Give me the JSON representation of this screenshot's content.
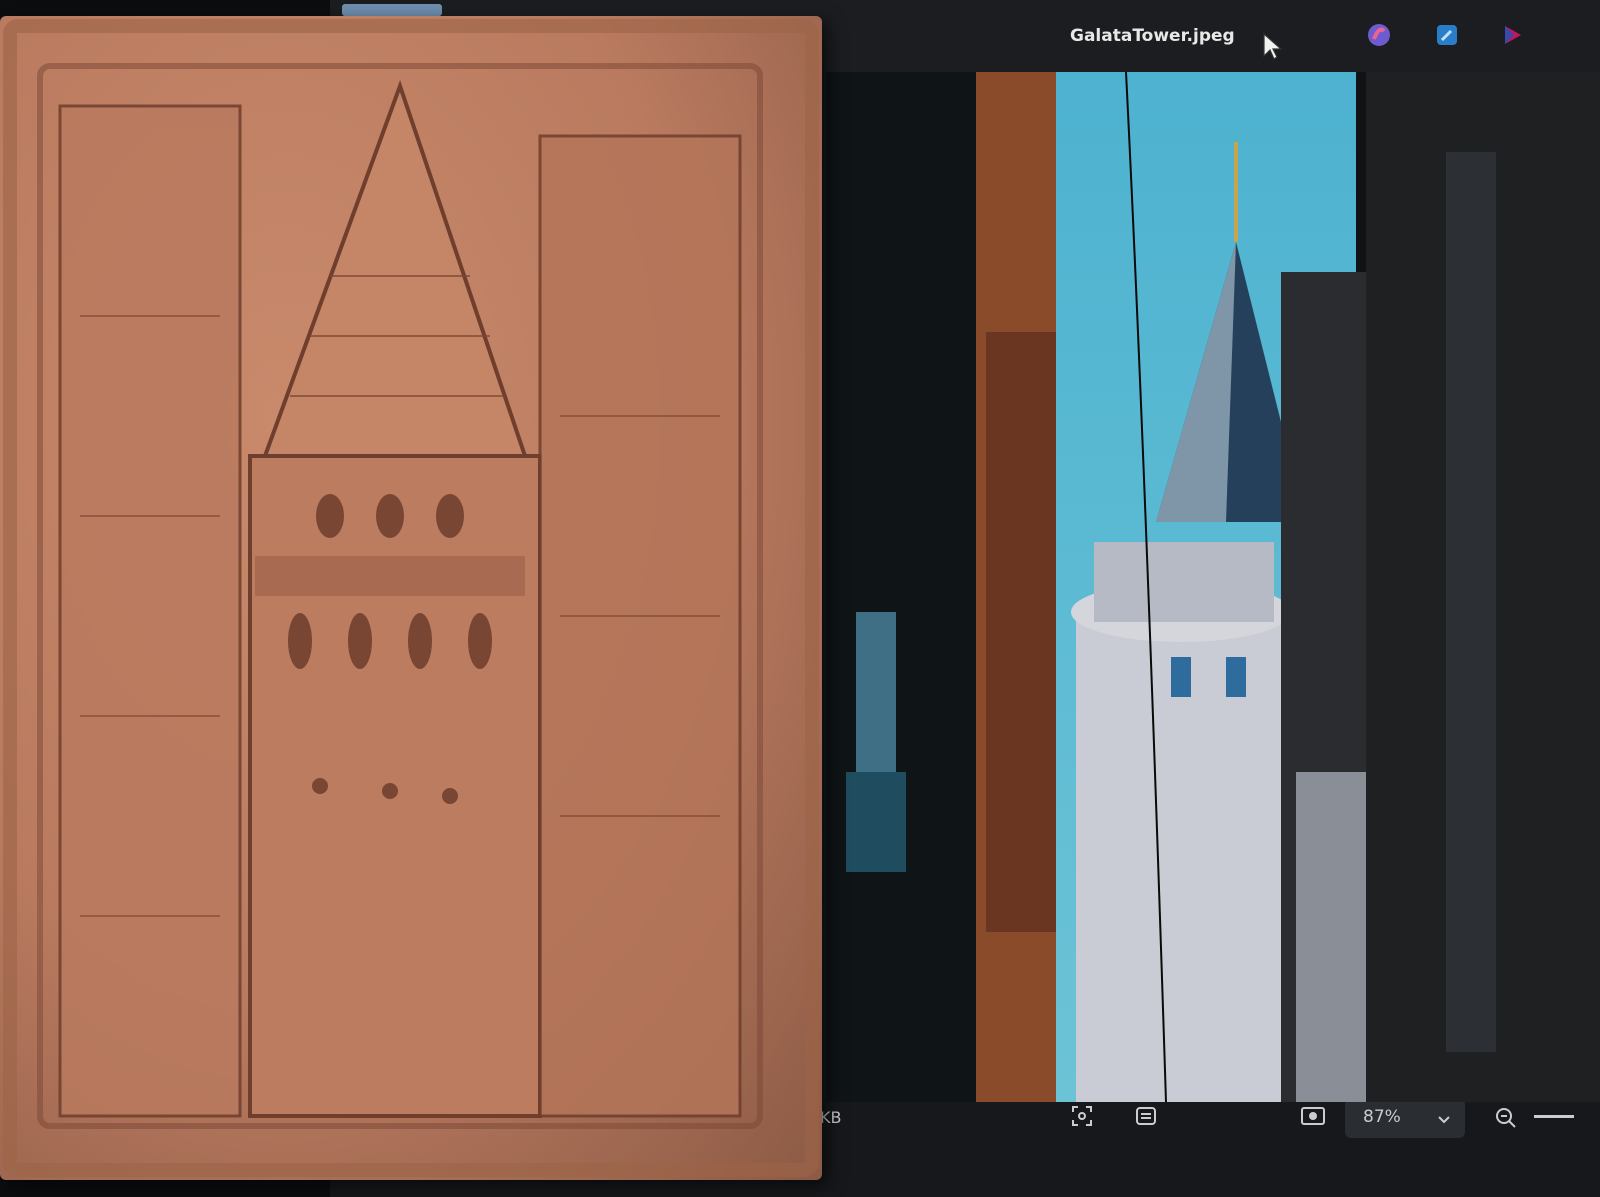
{
  "window": {
    "title": "GalataTower.jpeg"
  },
  "bottom_bar": {
    "file_size_fragment": "KB",
    "zoom_level": "87%"
  },
  "icons": {
    "cursor": "mouse-pointer-icon",
    "toolbar": [
      "copilot-icon",
      "edit-image-icon",
      "share-icon"
    ],
    "bottom": [
      "fit-to-screen-icon",
      "actual-size-icon",
      "slideshow-icon",
      "zoom-dropdown-chevron-icon",
      "zoom-out-icon"
    ]
  },
  "colors": {
    "sky": "#3fa9c8",
    "clay": "#b97a5f",
    "window_bg": "#17191c"
  }
}
